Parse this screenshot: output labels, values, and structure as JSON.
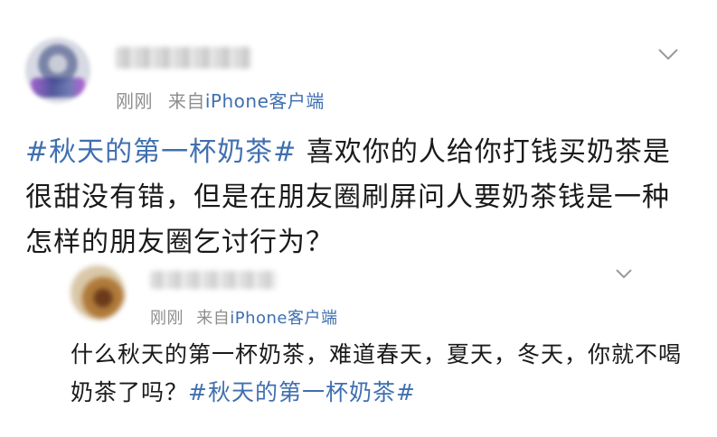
{
  "post": {
    "meta": {
      "time": "刚刚",
      "source_prefix": "来自",
      "source_app": "iPhone客户端"
    },
    "hashtag": "#秋天的第一杯奶茶#",
    "body": " 喜欢你的人给你打钱买奶茶是很甜没有错，但是在朋友圈刷屏问人要奶茶钱是一种怎样的朋友圈乞讨行为？",
    "expand_icon": "chevron-down-icon"
  },
  "reply": {
    "meta": {
      "time": "刚刚",
      "source_prefix": "来自",
      "source_app": "iPhone客户端"
    },
    "body": "什么秋天的第一杯奶茶，难道春天，夏天，冬天，你就不喝奶茶了吗？",
    "hashtag": "#秋天的第一杯奶茶#",
    "expand_icon": "chevron-down-icon"
  },
  "colors": {
    "link": "#3f6fb0",
    "meta": "#8d8d8d",
    "text": "#1a1a1a"
  }
}
